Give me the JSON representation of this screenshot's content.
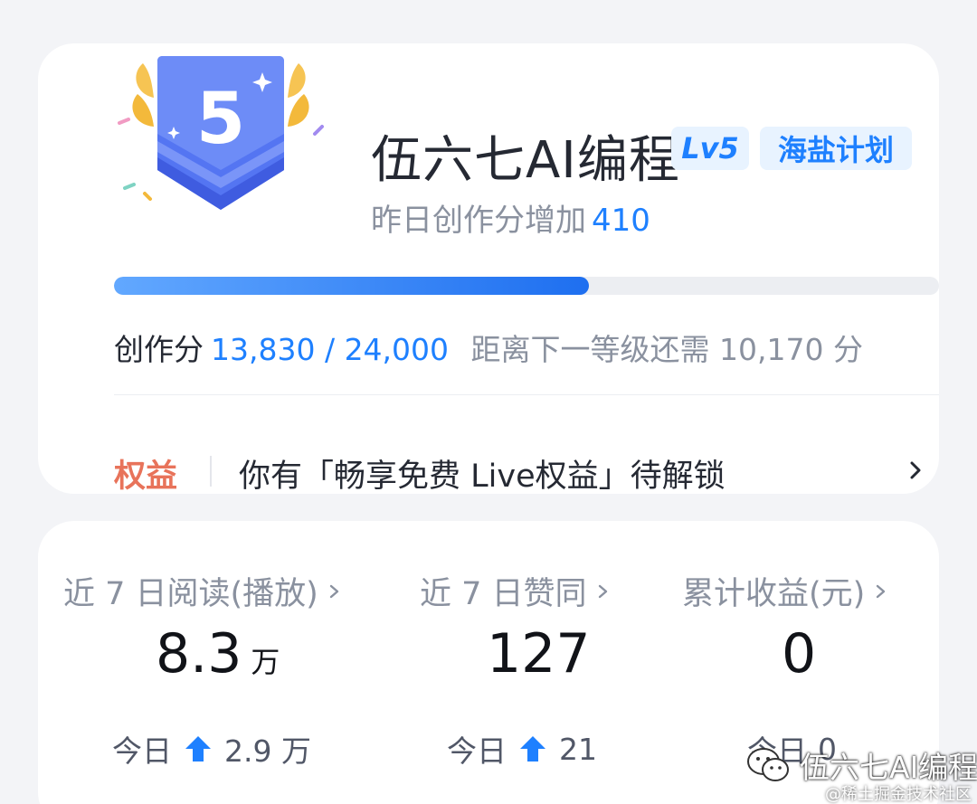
{
  "badge": {
    "level_number": "5"
  },
  "profile": {
    "name": "伍六七AI编程",
    "level_tag": "Lv5",
    "plan_tag": "海盐计划",
    "yesterday_label": "昨日创作分增加",
    "yesterday_value": "410"
  },
  "progress": {
    "fraction": 0.576,
    "score_label": "创作分",
    "score_values": "13,830 / 24,000",
    "next_level_text": "距离下一等级还需 10,170 分"
  },
  "rights": {
    "label": "权益",
    "text": "你有「畅享免费 Live权益」待解锁"
  },
  "stats": [
    {
      "title": "近 7 日阅读(播放)",
      "value": "8.3",
      "unit": "万",
      "today_label": "今日",
      "today_value": "2.9 万"
    },
    {
      "title": "近 7 日赞同",
      "value": "127",
      "unit": "",
      "today_label": "今日",
      "today_value": "21"
    },
    {
      "title": "累计收益(元)",
      "value": "0",
      "unit": "",
      "today_label": "今日",
      "today_value": "0"
    }
  ],
  "watermark": {
    "account": "伍六七AI编程",
    "source": "@稀土掘金技术社区"
  },
  "colors": {
    "accent": "#1e80ff",
    "rights": "#e8735a",
    "badge": "#4f6ef0"
  }
}
